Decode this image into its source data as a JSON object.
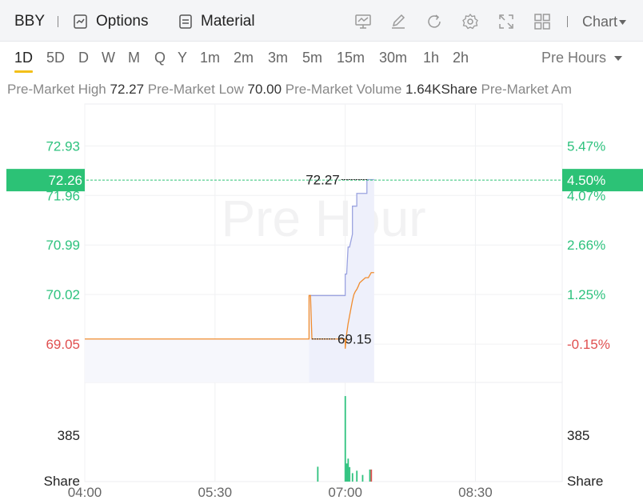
{
  "toolbar": {
    "ticker": "BBY",
    "options_label": "Options",
    "material_label": "Material",
    "chart_menu_label": "Chart"
  },
  "periods": [
    "1D",
    "5D",
    "D",
    "W",
    "M",
    "Q",
    "Y",
    "1m",
    "2m",
    "3m",
    "5m",
    "15m",
    "30m",
    "1h",
    "2h"
  ],
  "active_period": "1D",
  "session_selector": "Pre Hours",
  "stats": {
    "high_label": "Pre-Market High",
    "high_value": "72.27",
    "low_label": "Pre-Market Low",
    "low_value": "70.00",
    "volume_label": "Pre-Market Volume",
    "volume_value": "1.64KShare",
    "more_label": "Pre-Market Am"
  },
  "colors": {
    "up": "#2ec27e",
    "down": "#e04f4f",
    "price_line": "#f08c2e",
    "avg_line": "#9ba3e0",
    "highlight": "#2cc276"
  },
  "chart_data": {
    "type": "line",
    "watermark": "Pre Hour",
    "x_ticks": [
      "04:00",
      "05:30",
      "07:00",
      "08:30"
    ],
    "x_range": [
      "04:00",
      "09:30"
    ],
    "y_ticks_left": [
      "72.93",
      "71.96",
      "70.99",
      "70.02",
      "69.05"
    ],
    "y_ticks_right": [
      "5.47%",
      "4.07%",
      "2.66%",
      "1.25%",
      "-0.15%"
    ],
    "ylim": [
      68.3,
      73.75
    ],
    "reference_close": 69.15,
    "current_price_label": "72.26",
    "current_change_label": "4.50%",
    "current_price": 72.26,
    "high_annotation": "72.27",
    "high_value": 72.27,
    "low_annotation": "69.15",
    "low_value": 69.15,
    "price_series": {
      "x": [
        "04:00",
        "06:35",
        "06:35",
        "06:36",
        "06:37",
        "07:00",
        "07:00",
        "07:01",
        "07:02",
        "07:03",
        "07:04",
        "07:05",
        "07:06",
        "07:07",
        "07:08",
        "07:09",
        "07:10",
        "07:12",
        "07:14",
        "07:16",
        "07:18",
        "07:20"
      ],
      "y": [
        69.15,
        69.15,
        70.0,
        70.0,
        69.15,
        69.15,
        68.96,
        69.25,
        69.45,
        69.6,
        69.75,
        69.9,
        70.02,
        70.08,
        70.12,
        70.18,
        70.25,
        70.3,
        70.35,
        70.35,
        70.45,
        70.45
      ]
    },
    "avg_series": {
      "x": [
        "06:35",
        "06:36",
        "07:00",
        "07:00",
        "07:01",
        "07:02",
        "07:03",
        "07:05",
        "07:05",
        "07:08",
        "07:08",
        "07:10",
        "07:15",
        "07:15",
        "07:16",
        "07:20"
      ],
      "y": [
        70.0,
        70.0,
        70.0,
        70.42,
        70.42,
        70.95,
        70.95,
        71.2,
        71.75,
        71.75,
        72.0,
        72.0,
        72.0,
        72.27,
        72.27,
        72.27
      ]
    },
    "volume": {
      "ylabel": "Share",
      "tick": "385",
      "bars": [
        {
          "x": "06:41",
          "v": 123,
          "dir": "up"
        },
        {
          "x": "07:00",
          "v": 707,
          "dir": "up"
        },
        {
          "x": "07:01",
          "v": 150,
          "dir": "up"
        },
        {
          "x": "07:02",
          "v": 190,
          "dir": "up"
        },
        {
          "x": "07:03",
          "v": 120,
          "dir": "up"
        },
        {
          "x": "07:05",
          "v": 70,
          "dir": "up"
        },
        {
          "x": "07:08",
          "v": 90,
          "dir": "up"
        },
        {
          "x": "07:12",
          "v": 55,
          "dir": "up"
        },
        {
          "x": "07:17",
          "v": 100,
          "dir": "up"
        },
        {
          "x": "07:18",
          "v": 100,
          "dir": "down"
        }
      ]
    }
  }
}
